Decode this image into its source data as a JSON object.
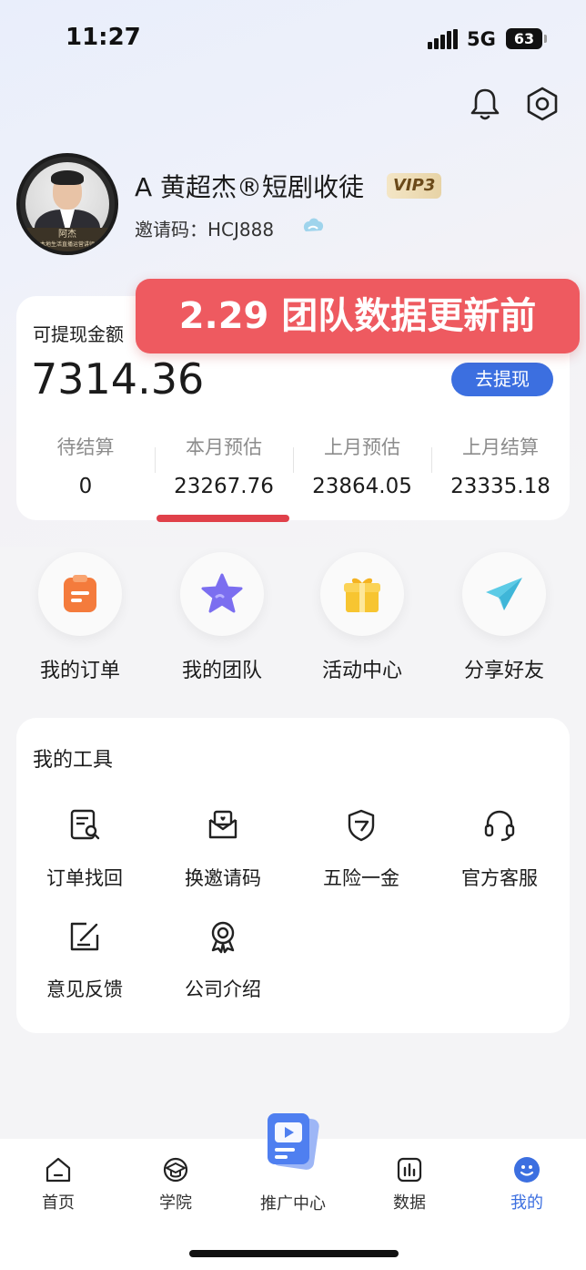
{
  "status_bar": {
    "time": "11:27",
    "network": "5G",
    "battery": "63"
  },
  "header_icons": [
    "bell-icon",
    "settings-icon"
  ],
  "profile": {
    "name": "A 黄超杰®短剧收徒",
    "vip": "VIP3",
    "invite_code": "邀请码：HCJ888",
    "avatar_tag_name": "阿杰",
    "avatar_tag_sub": "本地生活直播运营讲师"
  },
  "banner": {
    "text": "2.29 团队数据更新前"
  },
  "earnings": {
    "label": "可提现金额",
    "amount": "7314.36",
    "withdraw_label": "去提现",
    "stats": [
      {
        "label": "待结算",
        "value": "0"
      },
      {
        "label": "本月预估",
        "value": "23267.76"
      },
      {
        "label": "上月预估",
        "value": "23864.05"
      },
      {
        "label": "上月结算",
        "value": "23335.18"
      }
    ],
    "highlight_color": "#e0404a"
  },
  "quick_actions": [
    {
      "label": "我的订单",
      "icon": "order-icon"
    },
    {
      "label": "我的团队",
      "icon": "star-icon"
    },
    {
      "label": "活动中心",
      "icon": "gift-icon"
    },
    {
      "label": "分享好友",
      "icon": "paper-plane-icon"
    }
  ],
  "tools": {
    "title": "我的工具",
    "items": [
      {
        "label": "订单找回",
        "icon": "order-search-icon"
      },
      {
        "label": "换邀请码",
        "icon": "invite-mail-icon"
      },
      {
        "label": "五险一金",
        "icon": "shield-icon"
      },
      {
        "label": "官方客服",
        "icon": "headset-icon"
      },
      {
        "label": "意见反馈",
        "icon": "feedback-edit-icon"
      },
      {
        "label": "公司介绍",
        "icon": "award-icon"
      }
    ]
  },
  "bottom_nav": {
    "items": [
      {
        "label": "首页",
        "icon": "home-icon"
      },
      {
        "label": "学院",
        "icon": "graduation-cap-icon"
      },
      {
        "label": "推广中心",
        "icon": "promo-video-icon"
      },
      {
        "label": "数据",
        "icon": "bar-chart-icon"
      },
      {
        "label": "我的",
        "icon": "profile-face-icon",
        "active": true
      }
    ],
    "active_color": "#3c6fe0"
  }
}
